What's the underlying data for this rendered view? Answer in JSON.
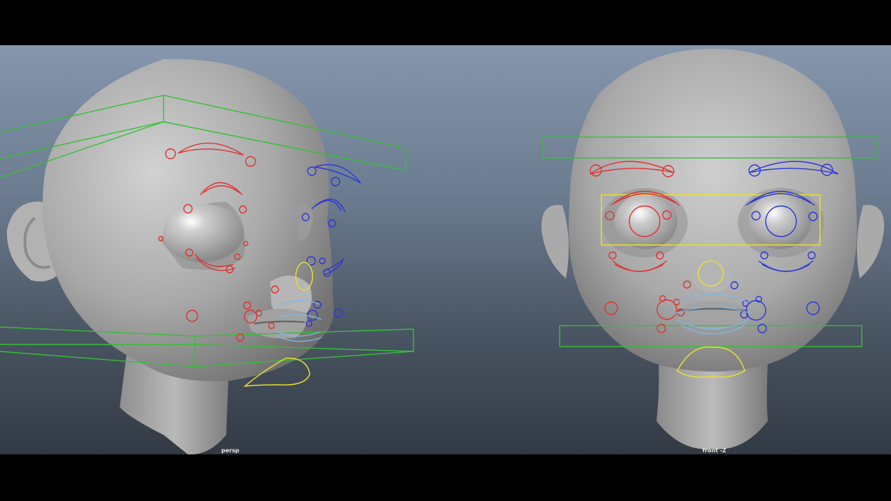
{
  "viewports": {
    "left": {
      "camera_label": "persp"
    },
    "right": {
      "camera_label": "front -Z"
    }
  },
  "colors": {
    "viewport_bg_top": "#8596ad",
    "viewport_bg_bottom": "#323a44",
    "skin": "#a8a8a8",
    "ctrl_red": "#e03030",
    "ctrl_blue": "#2a35d8",
    "ctrl_yellow": "#e8e030",
    "ctrl_green": "#35c035",
    "ctrl_lightblue": "#7fb8e8",
    "letterbox": "#000000"
  }
}
